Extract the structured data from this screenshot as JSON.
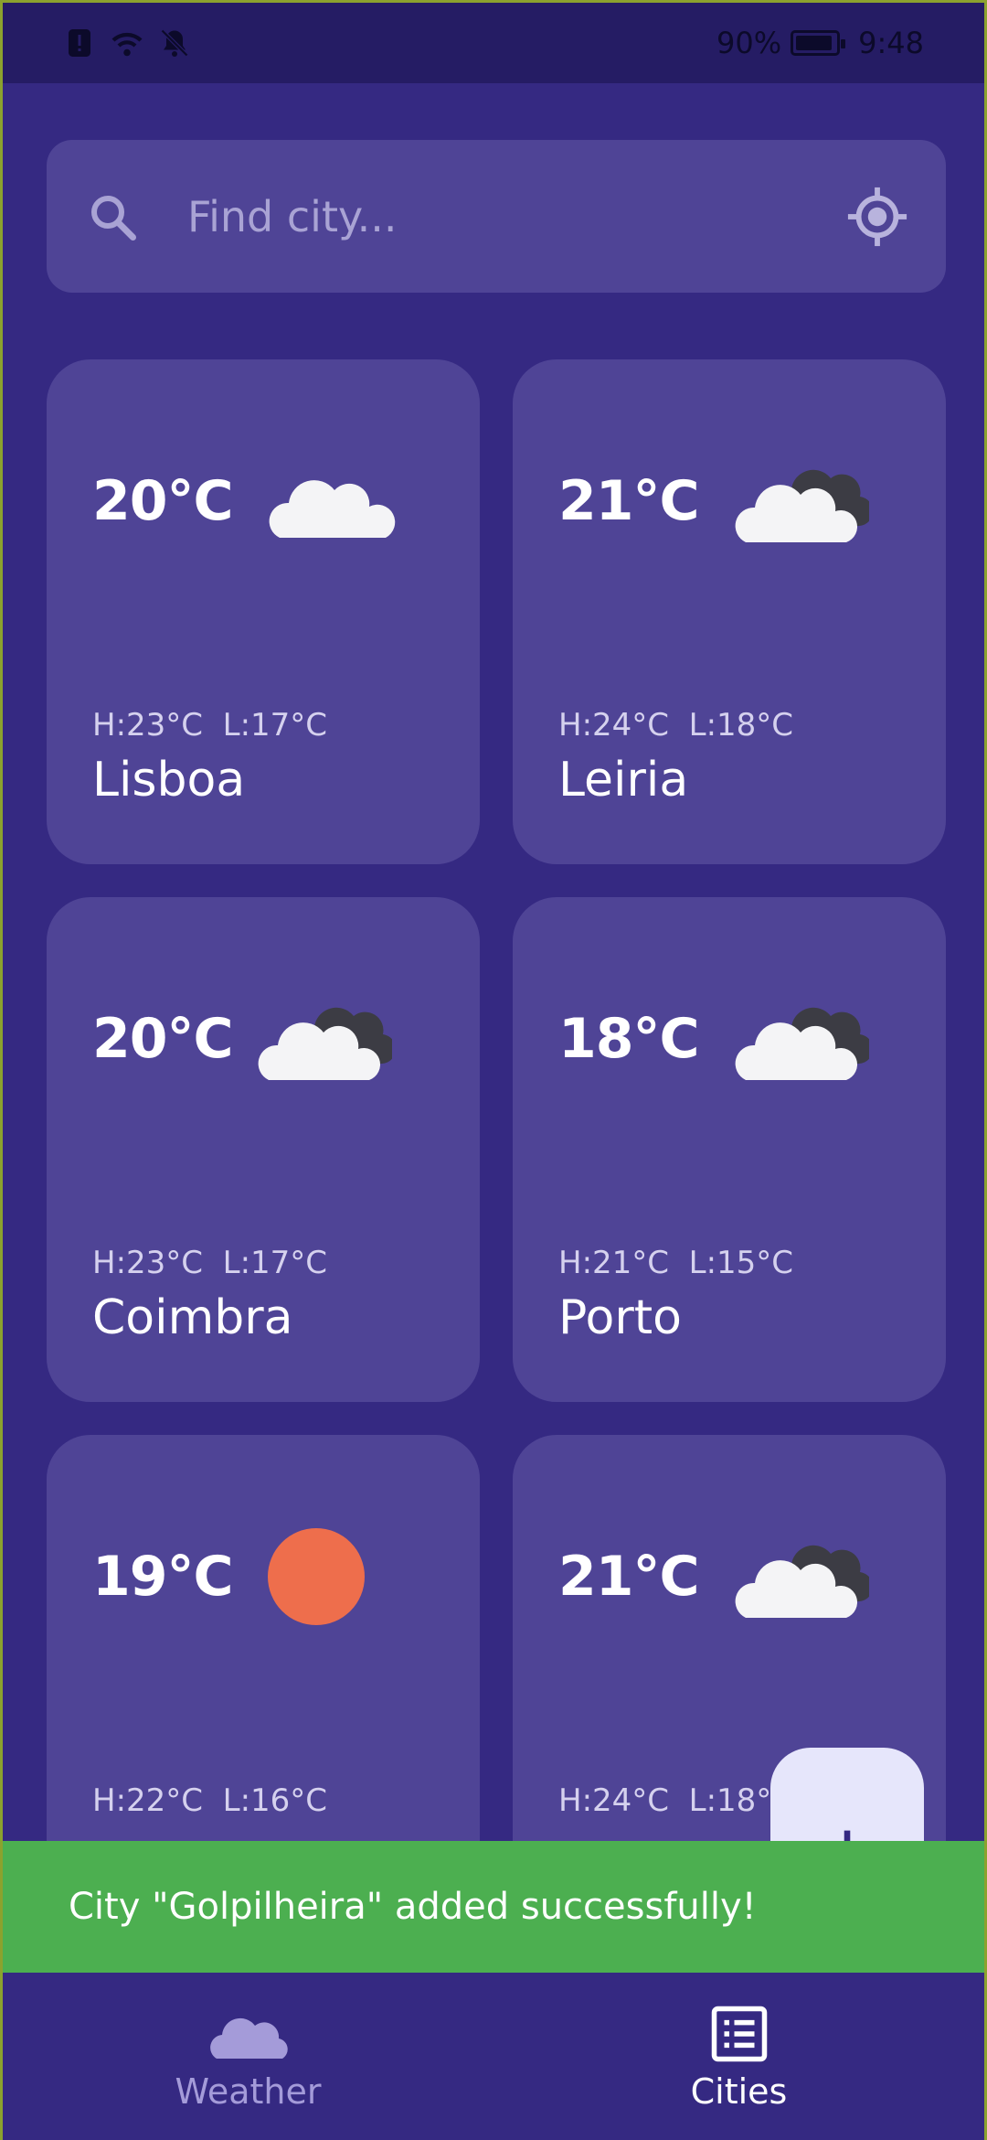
{
  "status_bar": {
    "battery": "90%",
    "time": "9:48"
  },
  "search": {
    "placeholder": "Find city..."
  },
  "cities": [
    {
      "temp": "20°C",
      "high_low": "H:23°C  L:17°C",
      "name": "Lisboa",
      "icon": "cloud-icon"
    },
    {
      "temp": "21°C",
      "high_low": "H:24°C  L:18°C",
      "name": "Leiria",
      "icon": "cloudy-icon"
    },
    {
      "temp": "20°C",
      "high_low": "H:23°C  L:17°C",
      "name": "Coimbra",
      "icon": "cloudy-icon"
    },
    {
      "temp": "18°C",
      "high_low": "H:21°C  L:15°C",
      "name": "Porto",
      "icon": "cloudy-icon"
    },
    {
      "temp": "19°C",
      "high_low": "H:22°C  L:16°C",
      "name": "",
      "icon": "sun-icon"
    },
    {
      "temp": "21°C",
      "high_low": "H:24°C  L:18°C",
      "name": "",
      "icon": "cloudy-icon"
    }
  ],
  "fab": {
    "label": "+"
  },
  "snackbar": {
    "message": "City \"Golpilheira\" added successfully!"
  },
  "bottom_nav": {
    "weather_label": "Weather",
    "cities_label": "Cities"
  },
  "colors": {
    "background": "#352982",
    "card": "#4f4496",
    "snackbar": "#4caf50",
    "sun": "#ee6e4c"
  }
}
